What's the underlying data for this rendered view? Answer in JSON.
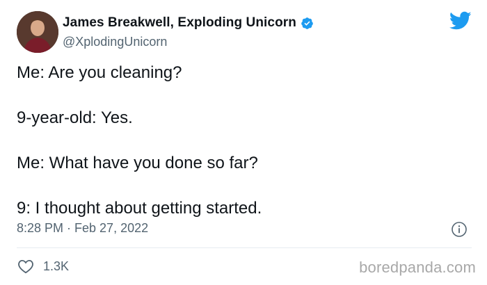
{
  "author": {
    "display_name": "James Breakwell, Exploding Unicorn",
    "handle": "@XplodingUnicorn",
    "avatar_icon": "profile-photo",
    "verified_icon": "verified-badge-icon"
  },
  "tweet": {
    "lines": [
      "Me: Are you cleaning?",
      "9-year-old: Yes.",
      "Me: What have you done so far?",
      "9: I thought about getting started."
    ],
    "timestamp": "8:28 PM · Feb 27, 2022",
    "likes": "1.3K"
  },
  "watermark": "boredpanda.com",
  "colors": {
    "twitter_blue": "#1d9bf0",
    "text": "#0f1419",
    "muted": "#536471"
  }
}
